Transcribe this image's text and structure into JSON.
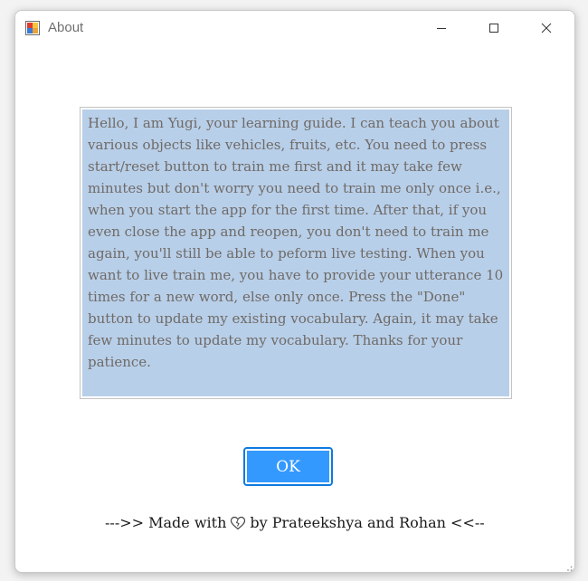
{
  "window": {
    "title": "About"
  },
  "about": {
    "message": "Hello, I am Yugi, your learning guide. I can teach you about various objects like vehicles, fruits, etc. You need to press start/reset button to train me first and it may take few minutes but don't worry you need to train me only once i.e., when you start the app for the first time. After that, if you even close the app and reopen, you don't need to train me again, you'll still be able to peform live testing. When you want to live train me, you have to provide your utterance 10 times for a new word, else only once. Press the \"Done\" button to update my existing vocabulary. Again, it may take few minutes to update my vocabulary. Thanks for your patience."
  },
  "ok_button": {
    "label": "OK"
  },
  "credits": {
    "prefix": "--->> Made with",
    "suffix": "by Prateekshya and Rohan <<--"
  },
  "icons": {
    "app": "app-icon",
    "minimize": "minimize-icon",
    "maximize": "maximize-icon",
    "close": "close-icon",
    "heart": "heart-icon",
    "resize": "resize-grip-icon"
  },
  "colors": {
    "selection_bg": "#b8cfe9",
    "ok_fill": "#3399ff",
    "ok_border": "#0e7ae0"
  }
}
